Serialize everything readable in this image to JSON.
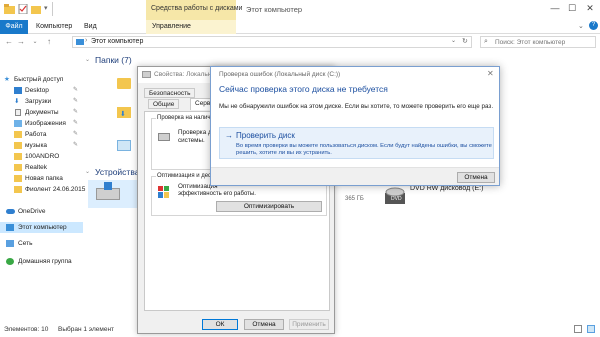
{
  "titlebar": {
    "context_tab": "Средства работы с дисками",
    "window_title": "Этот компьютер",
    "minimize": "—",
    "maximize": "☐",
    "close": "✕"
  },
  "ribbon": {
    "tabs": [
      "Файл",
      "Компьютер",
      "Вид",
      "Управление"
    ],
    "help": "?"
  },
  "address": {
    "back": "←",
    "forward": "→",
    "dropdown": "⌄",
    "up": "↑",
    "crumb": "Этот компьютер",
    "crumb_chevron": "›",
    "addr_dropdown": "⌄",
    "refresh": "↻",
    "search_placeholder": "Поиск: Этот компьютер"
  },
  "nav": {
    "items": [
      {
        "label": "Быстрый доступ",
        "icon": "star-icon",
        "pinned": false
      },
      {
        "label": "Desktop",
        "icon": "desktop-icon",
        "pinned": true
      },
      {
        "label": "Загрузки",
        "icon": "download-icon",
        "pinned": true
      },
      {
        "label": "Документы",
        "icon": "documents-icon",
        "pinned": true
      },
      {
        "label": "Изображения",
        "icon": "pictures-icon",
        "pinned": true
      },
      {
        "label": "Работа",
        "icon": "folder-icon",
        "pinned": true
      },
      {
        "label": "музыка",
        "icon": "folder-icon",
        "pinned": true
      },
      {
        "label": "100ANDRO",
        "icon": "folder-icon",
        "pinned": false
      },
      {
        "label": "Realtek",
        "icon": "folder-icon",
        "pinned": false
      },
      {
        "label": "Новая папка",
        "icon": "folder-icon",
        "pinned": false
      },
      {
        "label": "Фиолент 24.06.2015",
        "icon": "folder-icon",
        "pinned": false
      },
      {
        "label": "OneDrive",
        "icon": "onedrive-icon",
        "pinned": false
      },
      {
        "label": "Этот компьютер",
        "icon": "computer-icon",
        "pinned": false,
        "selected": true
      },
      {
        "label": "Сеть",
        "icon": "network-icon",
        "pinned": false
      },
      {
        "label": "Домашняя группа",
        "icon": "homegroup-icon",
        "pinned": false
      }
    ],
    "pin_glyph": "✎"
  },
  "main": {
    "folders_header": "Папки (7)",
    "devices_header": "Устройства",
    "drive_size_text": "365 ГБ",
    "dvd_label": "DVD RW дисковод (E:)",
    "dvd_badge": "DVD"
  },
  "status": {
    "count": "Элементов: 10",
    "selected": "Выбран 1 элемент"
  },
  "props": {
    "title": "Свойства: Локальный диск (C:)",
    "tabs_row1": [
      "Безопасность"
    ],
    "tabs_row2": [
      "Общие",
      "Серви"
    ],
    "check_legend": "Проверка на налич",
    "check_text_1": "Проверка д",
    "check_text_2": "системы.",
    "optimize_legend": "Оптимизация и деф",
    "optimize_text_1": "Оптимизация",
    "optimize_text_2": "эффективность его работы.",
    "optimize_button": "Оптимизировать",
    "ok": "ОК",
    "cancel": "Отмена",
    "apply": "Применить"
  },
  "check_dialog": {
    "title": "Проверка ошибок (Локальный диск (C:))",
    "close": "✕",
    "heading": "Сейчас проверка этого диска не требуется",
    "message": "Мы не обнаружили ошибок на этом диске. Если вы хотите, то можете проверить его еще раз.",
    "action_arrow": "→",
    "action_title": "Проверить диск",
    "action_desc": "Во время проверки вы можете пользоваться диском. Если будут найдены ошибки, вы сможете решить, хотите ли вы их устранить.",
    "cancel": "Отмена"
  },
  "colors": {
    "accent": "#1979ca",
    "context": "#f6e7a8",
    "link": "#1c4fa0",
    "selection": "#cce8ff"
  }
}
